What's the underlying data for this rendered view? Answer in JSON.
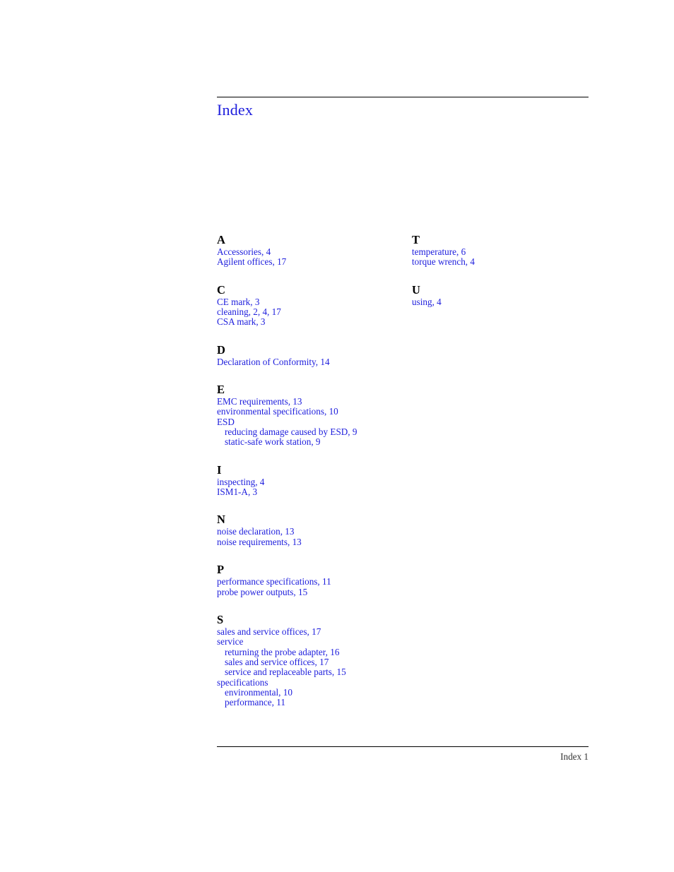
{
  "document": {
    "title": "Index",
    "title_color": "#2020dd",
    "entry_color": "#2020dd",
    "letter_color": "#000000",
    "rule_color": "#000000"
  },
  "footer": {
    "page_label": "Index 1"
  },
  "columns": [
    {
      "id": "left",
      "sections": [
        {
          "letter": "A",
          "entries": [
            {
              "text": "Accessories, 4",
              "level": 0
            },
            {
              "text": "Agilent offices, 17",
              "level": 0
            }
          ]
        },
        {
          "letter": "C",
          "entries": [
            {
              "text": "CE mark, 3",
              "level": 0
            },
            {
              "text": "cleaning, 2, 4, 17",
              "level": 0
            },
            {
              "text": "CSA mark, 3",
              "level": 0
            }
          ]
        },
        {
          "letter": "D",
          "entries": [
            {
              "text": "Declaration of Conformity, 14",
              "level": 0
            }
          ]
        },
        {
          "letter": "E",
          "entries": [
            {
              "text": "EMC requirements, 13",
              "level": 0
            },
            {
              "text": "environmental specifications, 10",
              "level": 0
            },
            {
              "text": "ESD",
              "level": 0
            },
            {
              "text": "reducing damage caused by ESD, 9",
              "level": 1
            },
            {
              "text": "static-safe work station, 9",
              "level": 1
            }
          ]
        },
        {
          "letter": "I",
          "entries": [
            {
              "text": "inspecting, 4",
              "level": 0
            },
            {
              "text": "ISM1-A, 3",
              "level": 0
            }
          ]
        },
        {
          "letter": "N",
          "entries": [
            {
              "text": "noise declaration, 13",
              "level": 0
            },
            {
              "text": "noise requirements, 13",
              "level": 0
            }
          ]
        },
        {
          "letter": "P",
          "entries": [
            {
              "text": "performance specifications, 11",
              "level": 0
            },
            {
              "text": "probe power outputs, 15",
              "level": 0
            }
          ]
        },
        {
          "letter": "S",
          "entries": [
            {
              "text": "sales and service offices, 17",
              "level": 0
            },
            {
              "text": "service",
              "level": 0
            },
            {
              "text": "returning the probe adapter, 16",
              "level": 1
            },
            {
              "text": "sales and service offices, 17",
              "level": 1
            },
            {
              "text": "service and replaceable parts, 15",
              "level": 1
            },
            {
              "text": "specifications",
              "level": 0
            },
            {
              "text": "environmental, 10",
              "level": 1
            },
            {
              "text": "performance, 11",
              "level": 1
            }
          ]
        }
      ]
    },
    {
      "id": "right",
      "sections": [
        {
          "letter": "T",
          "entries": [
            {
              "text": "temperature, 6",
              "level": 0
            },
            {
              "text": "torque wrench, 4",
              "level": 0
            }
          ]
        },
        {
          "letter": "U",
          "entries": [
            {
              "text": "using, 4",
              "level": 0
            }
          ]
        }
      ]
    }
  ]
}
